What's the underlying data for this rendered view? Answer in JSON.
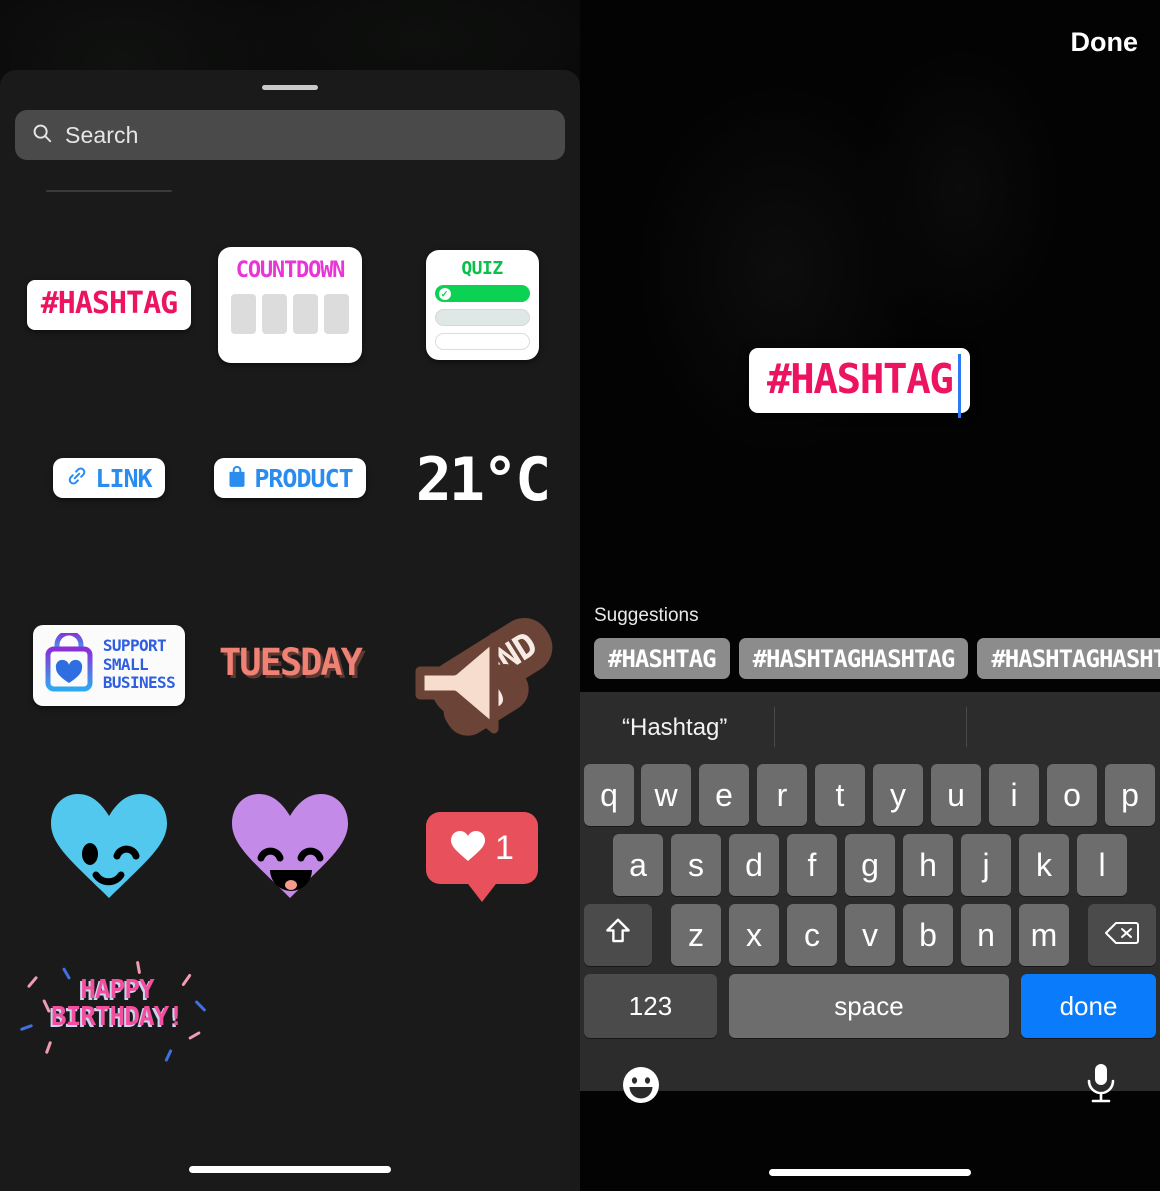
{
  "left_panel": {
    "search": {
      "placeholder": "Search",
      "icon": "search-icon"
    },
    "stickers": [
      {
        "id": "hashtag",
        "label": "#HASHTAG",
        "color": "#ec1361"
      },
      {
        "id": "countdown",
        "label": "COUNTDOWN",
        "color": "#e935d6"
      },
      {
        "id": "quiz",
        "label": "QUIZ",
        "color": "#0ac04a"
      },
      {
        "id": "link",
        "label": "LINK",
        "color": "#2b8cf0",
        "icon": "link-icon"
      },
      {
        "id": "product",
        "label": "PRODUCT",
        "color": "#2b8cf0",
        "icon": "shopping-bag-icon"
      },
      {
        "id": "temperature",
        "label": "21°C",
        "color": "#ffffff"
      },
      {
        "id": "support-small-business",
        "line1": "SUPPORT",
        "line2": "SMALL",
        "line3": "BUSINESS",
        "color": "#2f5fe0"
      },
      {
        "id": "tuesday",
        "label": "TUESDAY",
        "color": "#ef8274"
      },
      {
        "id": "sound-on",
        "line1": "SOUND",
        "line2": "ON",
        "color": "#f6e5dc"
      },
      {
        "id": "winking-heart",
        "label": "",
        "color": "#52c8ee"
      },
      {
        "id": "laughing-heart",
        "label": "",
        "color": "#c38ae8"
      },
      {
        "id": "like-counter",
        "label": "1",
        "color": "#e8505b"
      },
      {
        "id": "happy-birthday",
        "line1": "HAPPY",
        "line2": "BIRTHDAY!",
        "color": "#f44e9e"
      }
    ]
  },
  "right_panel": {
    "done_label": "Done",
    "editor": {
      "text": "#HASHTAG",
      "color": "#ec1361"
    },
    "suggestions": {
      "title": "Suggestions",
      "items": [
        "#HASHTAG",
        "#HASHTAGHASHTAG",
        "#HASHTAGHASHTAG"
      ]
    },
    "keyboard": {
      "predictive": [
        "“Hashtag”",
        "",
        ""
      ],
      "row1": [
        "q",
        "w",
        "e",
        "r",
        "t",
        "y",
        "u",
        "i",
        "o",
        "p"
      ],
      "row2": [
        "a",
        "s",
        "d",
        "f",
        "g",
        "h",
        "j",
        "k",
        "l"
      ],
      "row3": [
        "z",
        "x",
        "c",
        "v",
        "b",
        "n",
        "m"
      ],
      "shift_icon": "shift-icon",
      "backspace_icon": "backspace-icon",
      "numeric_label": "123",
      "space_label": "space",
      "return_label": "done",
      "emoji_icon": "emoji-icon",
      "mic_icon": "microphone-icon"
    }
  }
}
